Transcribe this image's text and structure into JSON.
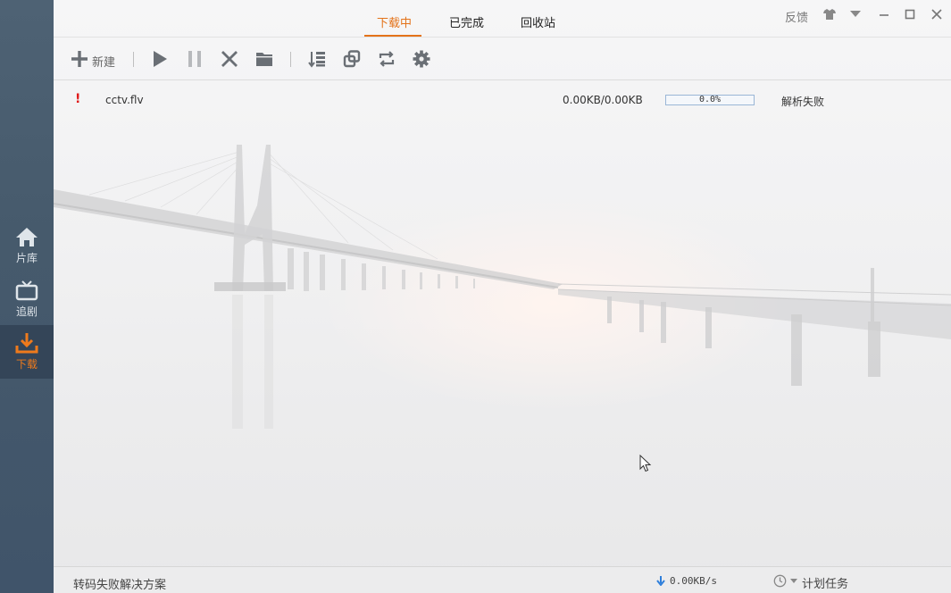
{
  "sidebar": {
    "items": [
      {
        "label": "片库",
        "icon": "home-icon"
      },
      {
        "label": "追剧",
        "icon": "tv-icon"
      },
      {
        "label": "下载",
        "icon": "download-icon",
        "active": true
      }
    ]
  },
  "header": {
    "tabs": [
      {
        "label": "下载中",
        "active": true
      },
      {
        "label": "已完成"
      },
      {
        "label": "回收站"
      }
    ],
    "feedback": "反馈"
  },
  "toolbar": {
    "new_label": "新建"
  },
  "downloads": [
    {
      "filename": "cctv.flv",
      "size": "0.00KB/0.00KB",
      "progress": 0,
      "progress_text": "0.0%",
      "status": "解析失败"
    }
  ],
  "statusbar": {
    "solution_link": "转码失败解决方案",
    "speed": "0.00KB/s",
    "schedule": "计划任务"
  },
  "colors": {
    "accent": "#e4731a",
    "sidebar": "#465a6c",
    "error": "#e01b1b"
  }
}
